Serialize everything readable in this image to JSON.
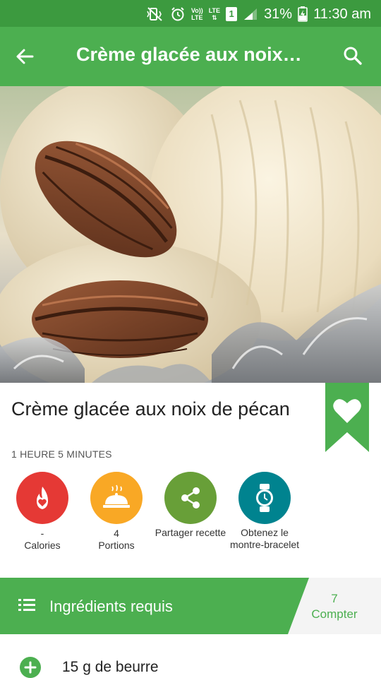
{
  "status_bar": {
    "lte_top": "Vo))",
    "lte_bottom": "LTE",
    "network": "LTE",
    "sim": "1",
    "battery": "31%",
    "time": "11:30 am",
    "icons": [
      "vibrate-mute-icon",
      "alarm-icon",
      "volte-icon",
      "lte-icon",
      "sim-icon",
      "signal-icon",
      "battery-charging-icon"
    ]
  },
  "app_bar": {
    "title": "Crème glacée aux noix…",
    "back_icon": "arrow-back-icon",
    "search_icon": "search-icon"
  },
  "recipe": {
    "title": "Crème glacée aux noix de pécan",
    "time": "1 HEURE 5 MINUTES",
    "bookmark_icon": "heart-icon"
  },
  "actions": [
    {
      "icon": "calories-flame-icon",
      "value": "-",
      "label": "Calories",
      "color": "#e53935"
    },
    {
      "icon": "serving-dish-icon",
      "value": "4",
      "label": "Portions",
      "color": "#f9a825"
    },
    {
      "icon": "share-icon",
      "value": "",
      "label": "Partager recette",
      "color": "#689f38"
    },
    {
      "icon": "watch-icon",
      "value": "",
      "label": "Obtenez le montre-bracelet",
      "color": "#00838f"
    }
  ],
  "ingredients_section": {
    "title": "Ingrédients requis",
    "count": "7",
    "count_label": "Compter"
  },
  "ingredients": [
    {
      "text": "15 g de beurre"
    }
  ],
  "colors": {
    "primary": "#4caf50",
    "status_bar": "#3c9a3f"
  }
}
